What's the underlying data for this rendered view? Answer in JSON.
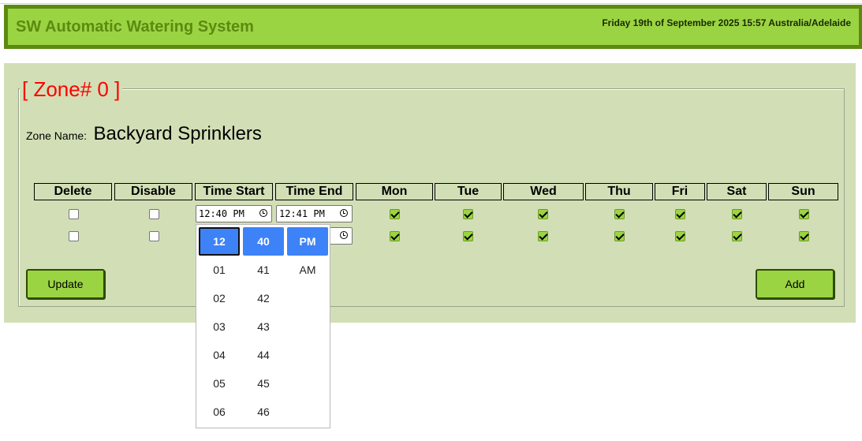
{
  "header": {
    "title": "SW Automatic Watering System",
    "datetime": "Friday 19th of September 2025 15:57 Australia/Adelaide"
  },
  "zone": {
    "legend": "[ Zone# 0 ]",
    "name_label": "Zone Name:",
    "name_value": "Backyard Sprinklers"
  },
  "table": {
    "headers": [
      "Delete",
      "Disable",
      "Time Start",
      "Time End",
      "Mon",
      "Tue",
      "Wed",
      "Thu",
      "Fri",
      "Sat",
      "Sun"
    ],
    "rows": [
      {
        "delete": false,
        "disable": false,
        "time_start": "12:40 PM",
        "time_end": "12:41 PM",
        "days": [
          true,
          true,
          true,
          true,
          true,
          true,
          true
        ]
      },
      {
        "delete": false,
        "disable": false,
        "time_start": "",
        "time_end": "",
        "days": [
          true,
          true,
          true,
          true,
          true,
          true,
          true
        ]
      }
    ]
  },
  "buttons": {
    "update": "Update",
    "add": "Add"
  },
  "time_picker": {
    "hours": [
      "12",
      "01",
      "02",
      "03",
      "04",
      "05",
      "06"
    ],
    "minutes": [
      "40",
      "41",
      "42",
      "43",
      "44",
      "45",
      "46"
    ],
    "meridiem": [
      "PM",
      "AM"
    ],
    "selected": {
      "hour": "12",
      "minute": "40",
      "meridiem": "PM"
    }
  },
  "colors": {
    "header_bg": "#9bd443",
    "header_border": "#5c8a10",
    "panel_bg": "#d2dfb6",
    "legend_text": "#ff0000",
    "picker_selected": "#3d82f7"
  }
}
